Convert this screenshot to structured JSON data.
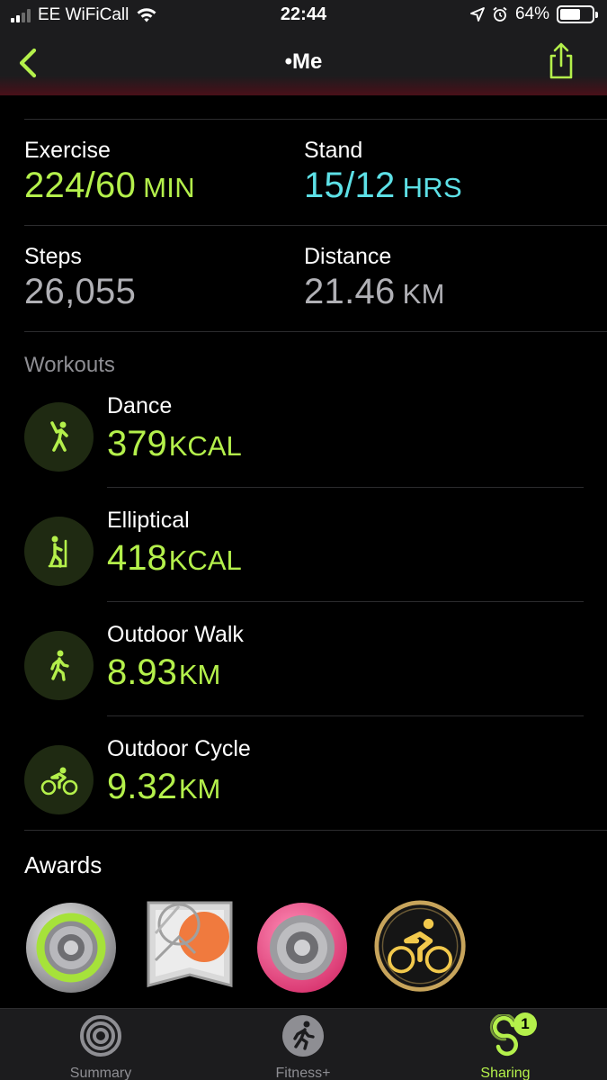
{
  "status_bar": {
    "carrier": "EE WiFiCall",
    "time": "22:44",
    "battery": "64%",
    "battery_level": 0.64
  },
  "nav": {
    "title": "•Me",
    "back_icon": "chevron-left-icon",
    "share_icon": "share-icon"
  },
  "metrics": {
    "exercise": {
      "label": "Exercise",
      "value": "224/60",
      "unit": "MIN",
      "color": "#b4f04b"
    },
    "stand": {
      "label": "Stand",
      "value": "15/12",
      "unit": "HRS",
      "color": "#5de0e6"
    },
    "steps": {
      "label": "Steps",
      "value": "26,055",
      "unit": "",
      "color": "#b0b0b5"
    },
    "distance": {
      "label": "Distance",
      "value": "21.46",
      "unit": "KM",
      "color": "#b0b0b5"
    }
  },
  "workouts_label": "Workouts",
  "workouts": [
    {
      "name": "Dance",
      "value": "379",
      "unit": "KCAL",
      "icon": "dance-icon"
    },
    {
      "name": "Elliptical",
      "value": "418",
      "unit": "KCAL",
      "icon": "elliptical-icon"
    },
    {
      "name": "Outdoor Walk",
      "value": "8.93",
      "unit": "KM",
      "icon": "walk-icon"
    },
    {
      "name": "Outdoor Cycle",
      "value": "9.32",
      "unit": "KM",
      "icon": "cycle-icon"
    }
  ],
  "awards_label": "Awards",
  "awards": [
    {
      "icon": "move-ring-award-icon"
    },
    {
      "icon": "challenge-award-icon"
    },
    {
      "icon": "exercise-ring-award-icon"
    },
    {
      "icon": "cycling-award-icon"
    }
  ],
  "tabs": [
    {
      "label": "Summary",
      "icon": "rings-icon"
    },
    {
      "label": "Fitness+",
      "icon": "runner-icon"
    },
    {
      "label": "Sharing",
      "icon": "sharing-icon",
      "badge": "1"
    }
  ],
  "colors": {
    "accent_green": "#b4f04b",
    "accent_cyan": "#5de0e6"
  }
}
